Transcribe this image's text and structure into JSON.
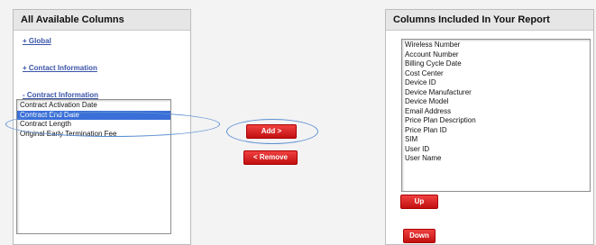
{
  "left_panel": {
    "title": "All Available Columns",
    "groups": [
      {
        "label": "+ Global"
      },
      {
        "label": "+ Contact Information"
      },
      {
        "label": "- Contract Information"
      }
    ],
    "available_columns": [
      "Contract Activation Date",
      "Contract End Date",
      "Contract Length",
      "Original Early Termination Fee"
    ],
    "selected_item": "Contract End Date"
  },
  "actions": {
    "add_label": "Add >",
    "remove_label": "< Remove"
  },
  "right_panel": {
    "title": "Columns Included In Your Report",
    "included_columns": [
      "Wireless Number",
      "Account Number",
      "Billing Cycle Date",
      "Cost Center",
      "Device ID",
      "Device Manufacturer",
      "Device Model",
      "Email Address",
      "Price Plan Description",
      "Price Plan ID",
      "SIM",
      "User ID",
      "User Name"
    ],
    "up_label": "Up",
    "down_label": "Down"
  },
  "colors": {
    "button_red": "#d62020",
    "link_blue": "#3a55a8",
    "selection_blue": "#3a6fd8",
    "annotation_ellipse": "#5b8fd4"
  }
}
